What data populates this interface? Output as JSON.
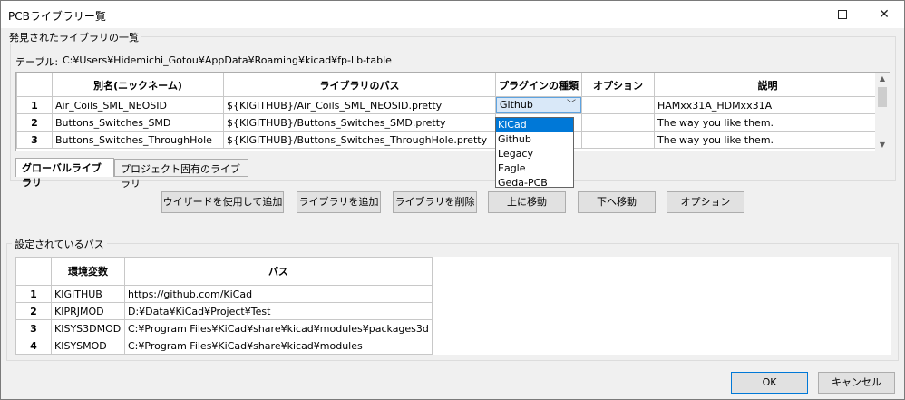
{
  "window": {
    "title": "PCBライブラリー覧",
    "minimize_label": "",
    "maximize_label": "",
    "close_label": "✕"
  },
  "libraries_group": {
    "label": "発見されたライブラリの一覧",
    "table_path_label": "テーブル:",
    "table_path": "C:¥Users¥Hidemichi_Gotou¥AppData¥Roaming¥kicad¥fp-lib-table",
    "columns": [
      "別名(ニックネーム)",
      "ライブラリのパス",
      "プラグインの種類",
      "オプション",
      "説明"
    ],
    "rows": [
      {
        "num": "1",
        "nickname": "Air_Coils_SML_NEOSID",
        "path": "${KIGITHUB}/Air_Coils_SML_NEOSID.pretty",
        "plugin": "Github",
        "options": "",
        "description": "HAMxx31A_HDMxx31A"
      },
      {
        "num": "2",
        "nickname": "Buttons_Switches_SMD",
        "path": "${KIGITHUB}/Buttons_Switches_SMD.pretty",
        "plugin": "",
        "options": "",
        "description": "The way you like them."
      },
      {
        "num": "3",
        "nickname": "Buttons_Switches_ThroughHole",
        "path": "${KIGITHUB}/Buttons_Switches_ThroughHole.pretty",
        "plugin": "",
        "options": "",
        "description": "The way you like them."
      }
    ],
    "plugin_options": [
      "KiCad",
      "Github",
      "Legacy",
      "Eagle",
      "Geda-PCB"
    ],
    "plugin_highlighted": "KiCad",
    "tabs": [
      "グローバルライブラリ",
      "プロジェクト固有のライブラリ"
    ]
  },
  "buttons": {
    "wizard": "ウイザードを使用して追加",
    "add": "ライブラリを追加",
    "remove": "ライブラリを削除",
    "up": "上に移動",
    "down": "下へ移動",
    "options": "オプション"
  },
  "paths_group": {
    "label": "設定されているパス",
    "columns": [
      "環境変数",
      "パス"
    ],
    "rows": [
      {
        "num": "1",
        "var": "KIGITHUB",
        "path": "https://github.com/KiCad"
      },
      {
        "num": "2",
        "var": "KIPRJMOD",
        "path": "D:¥Data¥KiCad¥Project¥Test"
      },
      {
        "num": "3",
        "var": "KISYS3DMOD",
        "path": "C:¥Program Files¥KiCad¥share¥kicad¥modules¥packages3d"
      },
      {
        "num": "4",
        "var": "KISYSMOD",
        "path": "C:¥Program Files¥KiCad¥share¥kicad¥modules"
      }
    ]
  },
  "footer": {
    "ok": "OK",
    "cancel": "キャンセル"
  },
  "colors": {
    "accent": "#0078d7",
    "window_bg": "#f0f0f0"
  }
}
